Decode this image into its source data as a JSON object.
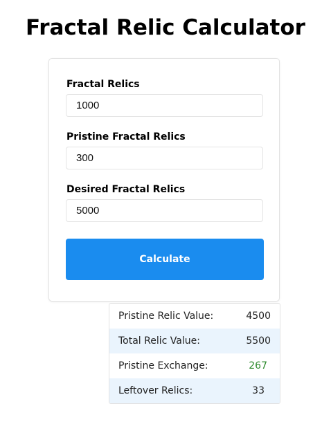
{
  "title": "Fractal Relic Calculator",
  "form": {
    "fields": [
      {
        "label": "Fractal Relics",
        "value": "1000"
      },
      {
        "label": "Pristine Fractal Relics",
        "value": "300"
      },
      {
        "label": "Desired Fractal Relics",
        "value": "5000"
      }
    ],
    "button_label": "Calculate"
  },
  "results": [
    {
      "label": "Pristine Relic Value:",
      "value": "4500"
    },
    {
      "label": "Total Relic Value:",
      "value": "5500"
    },
    {
      "label": "Pristine Exchange:",
      "value": "267"
    },
    {
      "label": "Leftover Relics:",
      "value": "33"
    }
  ],
  "colors": {
    "button": "#1a8cef",
    "row_shade": "#eaf4fd",
    "exchange_value": "#2e8b2e"
  }
}
